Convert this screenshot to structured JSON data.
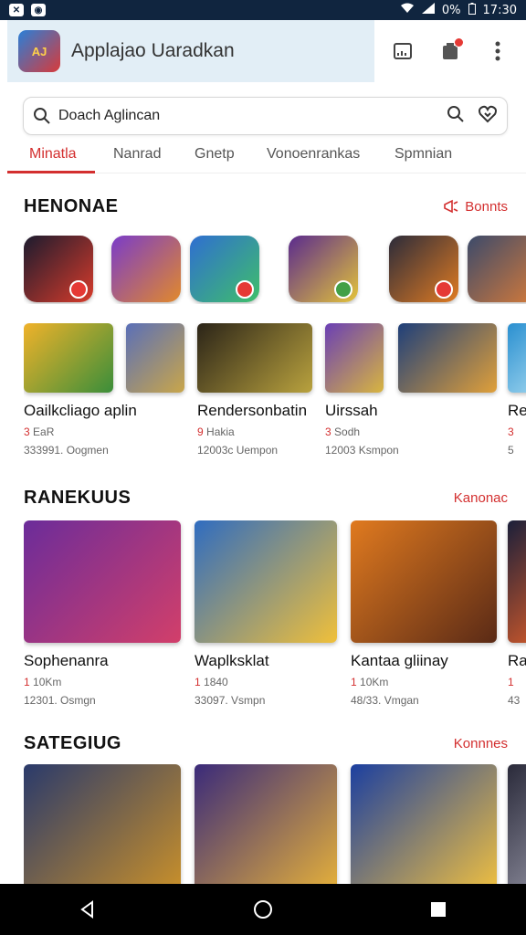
{
  "status": {
    "time": "17:30",
    "battery": "0%"
  },
  "app": {
    "title": "Applajao Uaradkan",
    "logo_text": "AJ"
  },
  "search": {
    "value": "Doach Aglincan"
  },
  "tabs": [
    {
      "label": "Minatla"
    },
    {
      "label": "Nanrad"
    },
    {
      "label": "Gnetp"
    },
    {
      "label": "Vonoenrankas"
    },
    {
      "label": "Spmnian"
    }
  ],
  "section1": {
    "title": "HENONAE",
    "more": "Bonnts"
  },
  "icons": [
    {
      "name": "app-icon-1",
      "colors": [
        "#1b1b2e",
        "#d83b2b"
      ],
      "badge": "#e53935"
    },
    {
      "name": "app-icon-2",
      "colors": [
        "#7a3cc9",
        "#e1892c"
      ],
      "badge": ""
    },
    {
      "name": "app-icon-3",
      "colors": [
        "#2f6ed1",
        "#3fbf6a"
      ],
      "badge": "#e53935"
    },
    {
      "name": "app-icon-4",
      "colors": [
        "#5a2a8e",
        "#e3c33a"
      ],
      "badge": "#43a047"
    },
    {
      "name": "app-icon-5",
      "colors": [
        "#2b2b3a",
        "#e07b22"
      ],
      "badge": "#e53935"
    },
    {
      "name": "app-icon-6",
      "colors": [
        "#3b4a6b",
        "#d47a3a"
      ],
      "badge": ""
    }
  ],
  "cards1": [
    {
      "title": "Oailkcliago aplin",
      "rating": "3",
      "size": "EaR",
      "downloads": "333991. Oogmen",
      "colors": [
        "#f0b22a",
        "#3a8e3a"
      ]
    },
    {
      "title": "",
      "rating": "",
      "size": "",
      "downloads": "",
      "colors": [
        "#5a6fb8",
        "#c9a64a"
      ]
    },
    {
      "title": "Rendersonbatin",
      "rating": "9",
      "size": "Hakia",
      "downloads": "12003c Uempon",
      "colors": [
        "#2b2418",
        "#b9a23e"
      ]
    },
    {
      "title": "Uirssah",
      "rating": "3",
      "size": "Sodh",
      "downloads": "12003 Ksmpon",
      "colors": [
        "#6a3fb5",
        "#d8b540"
      ]
    },
    {
      "title": "",
      "rating": "",
      "size": "",
      "downloads": "",
      "colors": [
        "#1e3f7a",
        "#e0a03a"
      ]
    },
    {
      "title": "Re",
      "rating": "3",
      "size": "",
      "downloads": "5",
      "colors": [
        "#2a8fd0",
        "#9fd6ef"
      ]
    }
  ],
  "section2": {
    "title": "RANEKUUS",
    "more": "Kanonac"
  },
  "cards2": [
    {
      "title": "Sophenanra",
      "rating": "1",
      "size": "10Km",
      "downloads": "12301. Osmgn",
      "colors": [
        "#6b2c9a",
        "#d23f6a"
      ]
    },
    {
      "title": "Waplksklat",
      "rating": "1",
      "size": "1840",
      "downloads": "33097. Vsmpn",
      "colors": [
        "#2f6cc0",
        "#f0c03a"
      ]
    },
    {
      "title": "Kantaa gliinay",
      "rating": "1",
      "size": "10Km",
      "downloads": "48/33. Vmgan",
      "colors": [
        "#e07a1f",
        "#5a2a16"
      ]
    },
    {
      "title": "Ra",
      "rating": "1",
      "size": "",
      "downloads": "43",
      "colors": [
        "#1a1f3a",
        "#d25a2a"
      ]
    }
  ],
  "section3": {
    "title": "SATEGIUG",
    "more": "Konnnes"
  },
  "cards3": [
    {
      "colors": [
        "#2a3a6b",
        "#c9902a"
      ]
    },
    {
      "colors": [
        "#3a2a7a",
        "#e6b13a"
      ]
    },
    {
      "colors": [
        "#1b3fa0",
        "#f0c040"
      ]
    },
    {
      "colors": [
        "#2a2a3a",
        "#8a8a9a"
      ]
    }
  ]
}
